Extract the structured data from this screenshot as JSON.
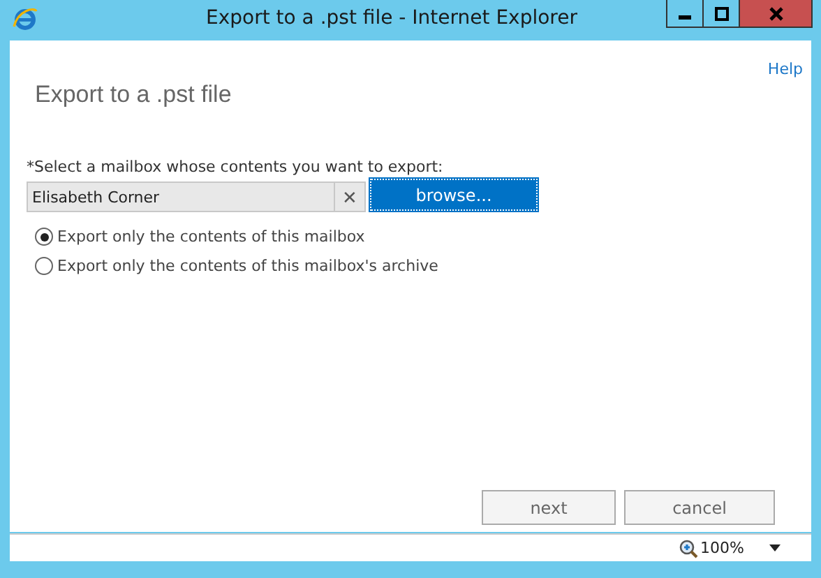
{
  "window": {
    "title": "Export to a .pst file - Internet Explorer"
  },
  "help": "Help",
  "heading": "Export to a .pst file",
  "mailbox": {
    "label": "*Select a mailbox whose contents you want to export:",
    "value": "Elisabeth Corner",
    "clear": "✕",
    "browse": "browse..."
  },
  "options": [
    {
      "label": "Export only the contents of this mailbox",
      "selected": true
    },
    {
      "label": "Export only the contents of this mailbox's archive",
      "selected": false
    }
  ],
  "buttons": [
    "next",
    "cancel"
  ],
  "status_bar": {
    "zoom": "100%"
  }
}
